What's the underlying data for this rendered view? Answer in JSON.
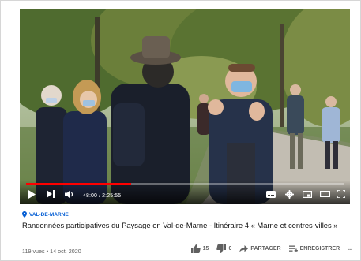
{
  "video": {
    "time_current": "48:00",
    "time_total": "2:25:55",
    "progress_fraction": 0.33
  },
  "channel": {
    "name": "VAL-DE-MARNE",
    "color": "#065fd4"
  },
  "title": "Randonnées participatives du Paysage en Val-de-Marne - Itinéraire 4 « Marne et centres-villes »",
  "views_date": "119 vues • 14 oct. 2020",
  "actions": {
    "like_count": "15",
    "dislike_count": "0",
    "share_label": "PARTAGER",
    "save_label": "ENREGISTRER",
    "more_label": "..."
  },
  "icons": [
    "play-icon",
    "next-icon",
    "volume-icon",
    "subtitles-icon",
    "settings-icon",
    "miniplayer-icon",
    "theater-icon",
    "fullscreen-icon",
    "location-pin-icon",
    "thumbs-up-icon",
    "thumbs-down-icon",
    "share-icon",
    "save-icon"
  ],
  "colors": {
    "progress": "#ff0000",
    "text_secondary": "#606060"
  }
}
